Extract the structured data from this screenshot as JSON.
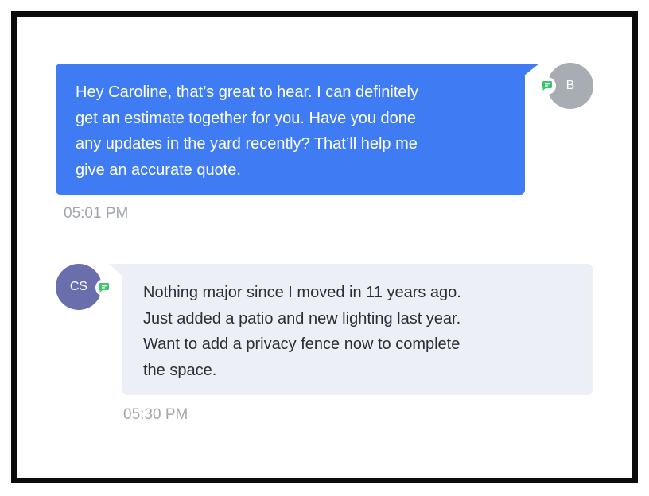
{
  "conversation": {
    "messages": [
      {
        "direction": "outgoing",
        "sender_initials": "B",
        "text": "Hey Caroline, that’s great to hear. I can definitely\nget an estimate together for you. Have you done\nany updates in the yard recently? That’ll help me\ngive an accurate quote.",
        "time": "05:01 PM",
        "channel_icon": "chat-bubble-icon"
      },
      {
        "direction": "incoming",
        "sender_initials": "CS",
        "text": "Nothing major since I moved in 11 years ago.\nJust added a patio and new lighting last year.\nWant to add a privacy fence now to complete\nthe space.",
        "time": "05:30 PM",
        "channel_icon": "chat-bubble-icon"
      }
    ]
  },
  "colors": {
    "outgoing_bubble": "#3f7cf4",
    "incoming_bubble": "#eceff6",
    "channel_badge": "#3ec46d",
    "agent_avatar": "#a7adb2",
    "customer_avatar": "#6a6ead"
  }
}
